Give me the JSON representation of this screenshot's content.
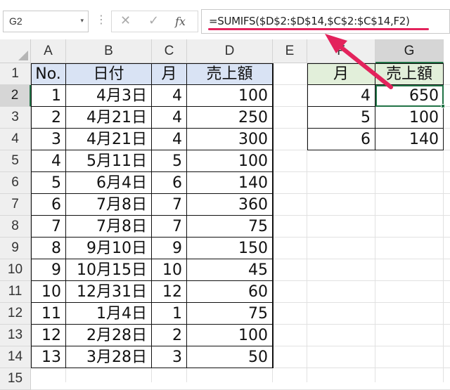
{
  "formula_bar": {
    "name_box": "G2",
    "name_box_arrow": "▾",
    "separator": "⋮",
    "cancel_icon": "✕",
    "enter_icon": "✓",
    "fx_label": "fx",
    "formula": "=SUMIFS($D$2:$D$14,$C$2:$C$14,F2)"
  },
  "columns": [
    "A",
    "B",
    "C",
    "D",
    "E",
    "F",
    "G"
  ],
  "selected_column": "G",
  "rows": [
    "1",
    "2",
    "3",
    "4",
    "5",
    "6",
    "7",
    "8",
    "9",
    "10",
    "11",
    "12",
    "13",
    "14",
    "15"
  ],
  "selected_row": "2",
  "table1": {
    "headers": [
      "No.",
      "日付",
      "月",
      "売上額"
    ],
    "rows": [
      [
        "1",
        "4月3日",
        "4",
        "100"
      ],
      [
        "2",
        "4月21日",
        "4",
        "250"
      ],
      [
        "3",
        "4月21日",
        "4",
        "300"
      ],
      [
        "4",
        "5月11日",
        "5",
        "100"
      ],
      [
        "5",
        "6月4日",
        "6",
        "140"
      ],
      [
        "6",
        "7月8日",
        "7",
        "360"
      ],
      [
        "7",
        "7月8日",
        "7",
        "75"
      ],
      [
        "8",
        "9月10日",
        "9",
        "150"
      ],
      [
        "9",
        "10月15日",
        "10",
        "45"
      ],
      [
        "10",
        "12月31日",
        "12",
        "60"
      ],
      [
        "11",
        "1月4日",
        "1",
        "75"
      ],
      [
        "12",
        "2月28日",
        "2",
        "100"
      ],
      [
        "13",
        "3月28日",
        "3",
        "50"
      ]
    ]
  },
  "table2": {
    "headers": [
      "月",
      "売上額"
    ],
    "rows": [
      [
        "4",
        "650"
      ],
      [
        "5",
        "100"
      ],
      [
        "6",
        "140"
      ]
    ]
  },
  "colors": {
    "table1_header_fill": "#d9e3f4",
    "table2_header_fill": "#e2efda",
    "selection": "#217346",
    "annotation": "#e3235c"
  }
}
